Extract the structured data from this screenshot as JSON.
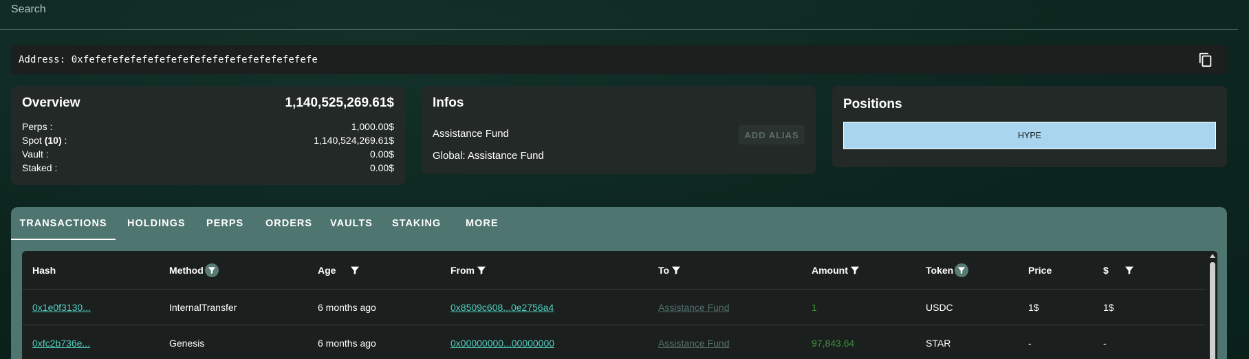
{
  "search": {
    "placeholder": "Search"
  },
  "address": {
    "label": "Address: 0xfefefefefefefefefefefefefefefefefefefefe"
  },
  "overview": {
    "title": "Overview",
    "total": "1,140,525,269.61$",
    "rows": [
      {
        "label": "Perps :",
        "value": "1,000.00$"
      },
      {
        "label_prefix": "Spot ",
        "label_bold": "(10)",
        "label_suffix": " :",
        "value": "1,140,524,269.61$"
      },
      {
        "label": "Vault :",
        "value": "0.00$"
      },
      {
        "label": "Staked :",
        "value": "0.00$"
      }
    ]
  },
  "infos": {
    "title": "Infos",
    "name": "Assistance Fund",
    "global": "Global: Assistance Fund",
    "add_alias": "ADD ALIAS"
  },
  "positions": {
    "title": "Positions",
    "bar_label": "HYPE"
  },
  "tabs": [
    "TRANSACTIONS",
    "HOLDINGS",
    "PERPS",
    "ORDERS",
    "VAULTS",
    "STAKING",
    "MORE"
  ],
  "table": {
    "headers": [
      "Hash",
      "Method",
      "Age",
      "From",
      "To",
      "Amount",
      "Token",
      "Price",
      "$"
    ],
    "rows": [
      {
        "hash": "0x1e0f3130...",
        "method": "InternalTransfer",
        "age": "6 months ago",
        "from": "0x8509c608...0e2756a4",
        "to": "Assistance Fund",
        "amount": "1",
        "token": "USDC",
        "price": "1$",
        "usd": "1$"
      },
      {
        "hash": "0xfc2b736e...",
        "method": "Genesis",
        "age": "6 months ago",
        "from": "0x00000000...00000000",
        "to": "Assistance Fund",
        "amount": "97,843.64",
        "token": "STAR",
        "price": "-",
        "usd": "-"
      }
    ]
  },
  "colors": {
    "background": "#0b231d",
    "card": "#232927",
    "panel": "#4e756f",
    "link": "#4fd1c0",
    "amount": "#3f8f3a",
    "hype_bar": "#a9d6ee"
  }
}
